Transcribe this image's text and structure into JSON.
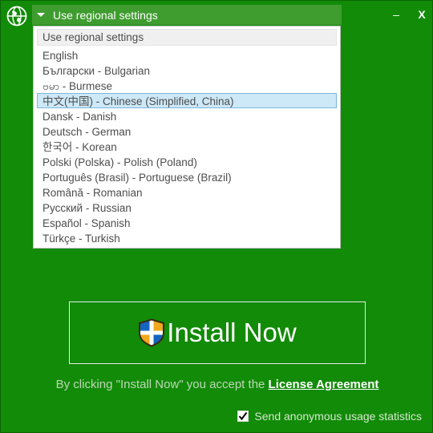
{
  "window": {
    "icon": "globe-icon",
    "minimize_label": "‒",
    "close_label": "X"
  },
  "language_combo": {
    "selected_label": "Use regional settings",
    "arrow_icon": "chevron-down-icon",
    "expanded": true,
    "options": [
      {
        "label": "Use regional settings",
        "state": "header"
      },
      {
        "label": "English",
        "state": "normal"
      },
      {
        "label": "Български - Bulgarian",
        "state": "normal"
      },
      {
        "label": "ဗမာ - Burmese",
        "state": "normal"
      },
      {
        "label": "中文(中国) - Chinese (Simplified, China)",
        "state": "selected"
      },
      {
        "label": "Dansk - Danish",
        "state": "normal"
      },
      {
        "label": "Deutsch - German",
        "state": "normal"
      },
      {
        "label": "한국어 - Korean",
        "state": "normal"
      },
      {
        "label": "Polski (Polska) - Polish (Poland)",
        "state": "normal"
      },
      {
        "label": "Português (Brasil) - Portuguese (Brazil)",
        "state": "normal"
      },
      {
        "label": "Română - Romanian",
        "state": "normal"
      },
      {
        "label": "Русский - Russian",
        "state": "normal"
      },
      {
        "label": "Español - Spanish",
        "state": "normal"
      },
      {
        "label": "Türkçe - Turkish",
        "state": "normal"
      }
    ]
  },
  "install": {
    "label": "Install Now",
    "icon": "shield-icon"
  },
  "footer": {
    "legal_prefix": "By clicking \"Install Now\" you accept the ",
    "license_link": "License Agreement",
    "stats_label": "Send anonymous usage statistics",
    "stats_checked": true,
    "check_glyph": "✔"
  },
  "colors": {
    "background": "#128b08",
    "combo_header": "#3f9c2f",
    "selection": "#cde8f7",
    "selection_border": "#7cb8dd",
    "list_background": "#ffffff",
    "list_header_row": "#f0f0f0",
    "item_text": "#4d4d4d",
    "muted_text": "#bcd8b6"
  }
}
